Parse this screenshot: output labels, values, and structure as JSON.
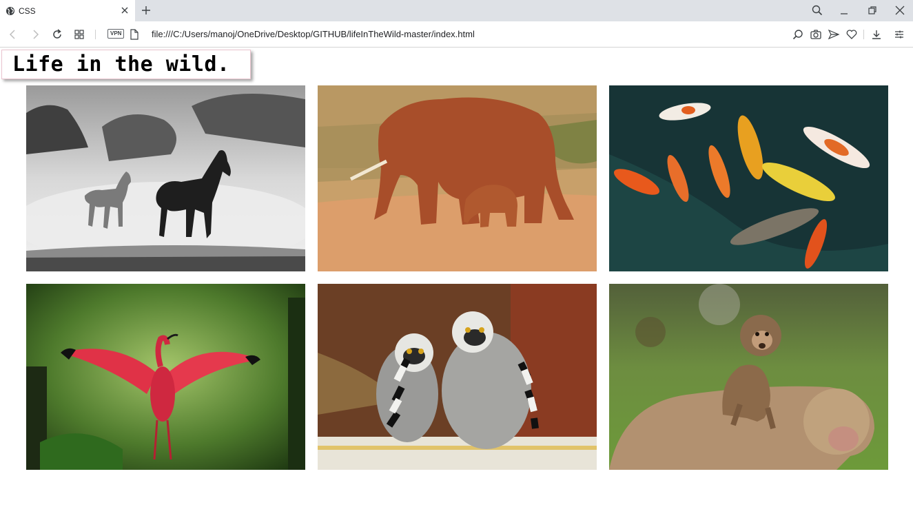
{
  "browser": {
    "tab": {
      "title": "CSS",
      "favicon": "globe-icon"
    },
    "new_tab_icon": "plus-icon",
    "url": "file:///C:/Users/manoj/OneDrive/Desktop/GITHUB/lifeInTheWild-master/index.html",
    "vpn_label": "VPN",
    "toolbar_icons": [
      "zoom-icon",
      "camera-icon",
      "send-icon",
      "heart-icon",
      "download-icon",
      "easy-setup-icon"
    ],
    "window_controls": [
      "search-icon",
      "minimize-icon",
      "restore-icon",
      "close-icon"
    ]
  },
  "page": {
    "heading": "Life in the wild.",
    "gallery": [
      {
        "subject": "horses",
        "tone": "grayscale"
      },
      {
        "subject": "elephants",
        "tone": "warm"
      },
      {
        "subject": "koi-fish",
        "tone": "dark-teal"
      },
      {
        "subject": "scarlet-ibis",
        "tone": "green"
      },
      {
        "subject": "ring-tailed-lemurs",
        "tone": "brown"
      },
      {
        "subject": "macaques",
        "tone": "green-brown"
      }
    ]
  },
  "colors": {
    "tabbar": "#dee1e6",
    "heading_border": "#eac4cf"
  }
}
